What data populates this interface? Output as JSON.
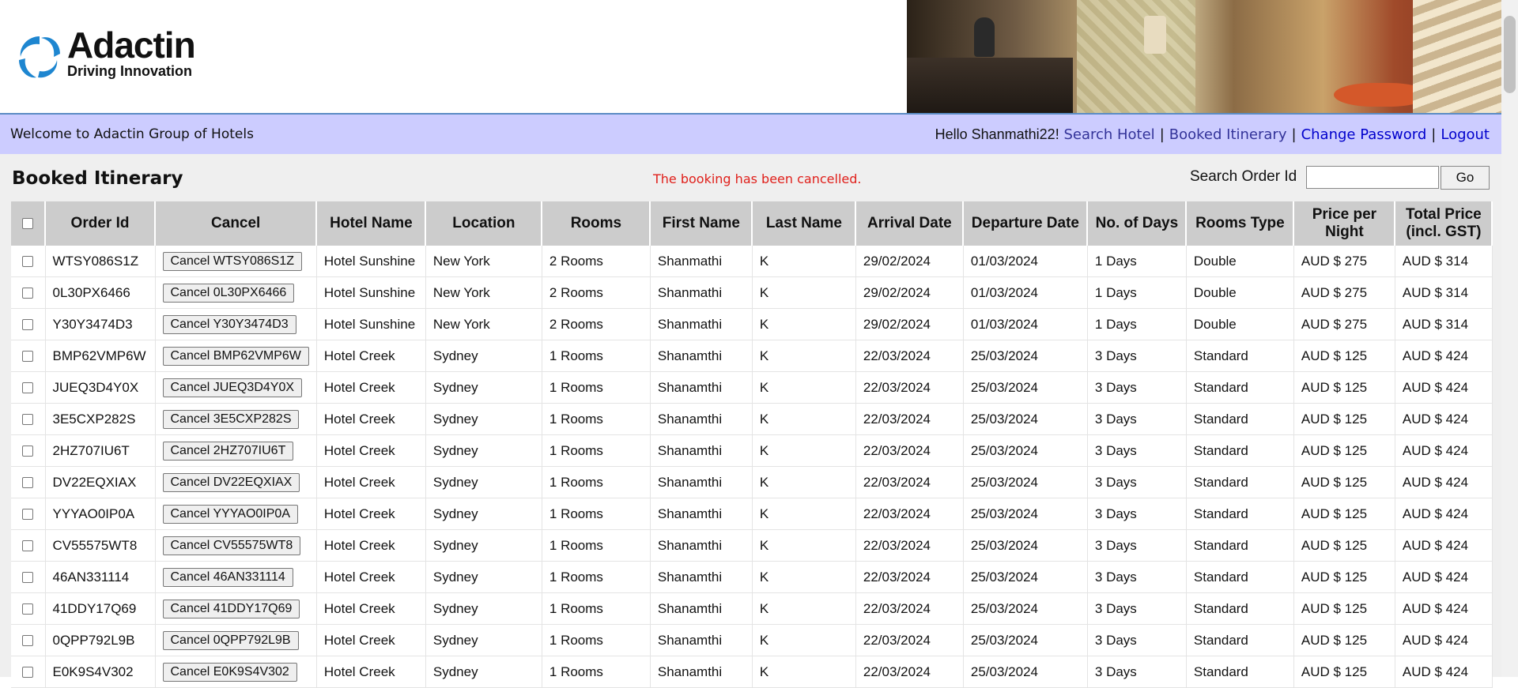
{
  "header": {
    "logo_name": "Adactin",
    "logo_tagline": "Driving Innovation",
    "colors": {
      "logo_blue": "#1e86d0",
      "header_line": "#5b8cc4"
    }
  },
  "welcome_bar": {
    "welcome_text": "Welcome to Adactin Group of Hotels",
    "hello": "Hello Shanmathi22!",
    "links": [
      "Search Hotel",
      "Booked Itinerary",
      "Change Password",
      "Logout"
    ],
    "separator": "|",
    "colors": {
      "bar_bg": "#ccccff",
      "link": "#333399"
    }
  },
  "page": {
    "title": "Booked Itinerary",
    "status_message": "The booking has been cancelled.",
    "status_color": "#e0201b",
    "search_label": "Search Order Id",
    "search_value": "",
    "go_label": "Go"
  },
  "table": {
    "headers": [
      "",
      "Order Id",
      "Cancel",
      "Hotel Name",
      "Location",
      "Rooms",
      "First Name",
      "Last Name",
      "Arrival Date",
      "Departure Date",
      "No. of Days",
      "Rooms Type",
      "Price per Night",
      "Total Price (incl. GST)"
    ],
    "rows": [
      {
        "order_id": "WTSY086S1Z",
        "cancel": "Cancel WTSY086S1Z",
        "hotel": "Hotel Sunshine",
        "location": "New York",
        "rooms": "2 Rooms",
        "first": "Shanmathi",
        "last": "K",
        "arrival": "29/02/2024",
        "departure": "01/03/2024",
        "days": "1 Days",
        "type": "Double",
        "price": "AUD $ 275",
        "total": "AUD $ 314"
      },
      {
        "order_id": "0L30PX6466",
        "cancel": "Cancel 0L30PX6466",
        "hotel": "Hotel Sunshine",
        "location": "New York",
        "rooms": "2 Rooms",
        "first": "Shanmathi",
        "last": "K",
        "arrival": "29/02/2024",
        "departure": "01/03/2024",
        "days": "1 Days",
        "type": "Double",
        "price": "AUD $ 275",
        "total": "AUD $ 314"
      },
      {
        "order_id": "Y30Y3474D3",
        "cancel": "Cancel Y30Y3474D3",
        "hotel": "Hotel Sunshine",
        "location": "New York",
        "rooms": "2 Rooms",
        "first": "Shanmathi",
        "last": "K",
        "arrival": "29/02/2024",
        "departure": "01/03/2024",
        "days": "1 Days",
        "type": "Double",
        "price": "AUD $ 275",
        "total": "AUD $ 314"
      },
      {
        "order_id": "BMP62VMP6W",
        "cancel": "Cancel BMP62VMP6W",
        "hotel": "Hotel Creek",
        "location": "Sydney",
        "rooms": "1 Rooms",
        "first": "Shanamthi",
        "last": "K",
        "arrival": "22/03/2024",
        "departure": "25/03/2024",
        "days": "3 Days",
        "type": "Standard",
        "price": "AUD $ 125",
        "total": "AUD $ 424"
      },
      {
        "order_id": "JUEQ3D4Y0X",
        "cancel": "Cancel JUEQ3D4Y0X",
        "hotel": "Hotel Creek",
        "location": "Sydney",
        "rooms": "1 Rooms",
        "first": "Shanamthi",
        "last": "K",
        "arrival": "22/03/2024",
        "departure": "25/03/2024",
        "days": "3 Days",
        "type": "Standard",
        "price": "AUD $ 125",
        "total": "AUD $ 424"
      },
      {
        "order_id": "3E5CXP282S",
        "cancel": "Cancel 3E5CXP282S",
        "hotel": "Hotel Creek",
        "location": "Sydney",
        "rooms": "1 Rooms",
        "first": "Shanamthi",
        "last": "K",
        "arrival": "22/03/2024",
        "departure": "25/03/2024",
        "days": "3 Days",
        "type": "Standard",
        "price": "AUD $ 125",
        "total": "AUD $ 424"
      },
      {
        "order_id": "2HZ707IU6T",
        "cancel": "Cancel 2HZ707IU6T",
        "hotel": "Hotel Creek",
        "location": "Sydney",
        "rooms": "1 Rooms",
        "first": "Shanamthi",
        "last": "K",
        "arrival": "22/03/2024",
        "departure": "25/03/2024",
        "days": "3 Days",
        "type": "Standard",
        "price": "AUD $ 125",
        "total": "AUD $ 424"
      },
      {
        "order_id": "DV22EQXIAX",
        "cancel": "Cancel DV22EQXIAX",
        "hotel": "Hotel Creek",
        "location": "Sydney",
        "rooms": "1 Rooms",
        "first": "Shanamthi",
        "last": "K",
        "arrival": "22/03/2024",
        "departure": "25/03/2024",
        "days": "3 Days",
        "type": "Standard",
        "price": "AUD $ 125",
        "total": "AUD $ 424"
      },
      {
        "order_id": "YYYAO0IP0A",
        "cancel": "Cancel YYYAO0IP0A",
        "hotel": "Hotel Creek",
        "location": "Sydney",
        "rooms": "1 Rooms",
        "first": "Shanamthi",
        "last": "K",
        "arrival": "22/03/2024",
        "departure": "25/03/2024",
        "days": "3 Days",
        "type": "Standard",
        "price": "AUD $ 125",
        "total": "AUD $ 424"
      },
      {
        "order_id": "CV55575WT8",
        "cancel": "Cancel CV55575WT8",
        "hotel": "Hotel Creek",
        "location": "Sydney",
        "rooms": "1 Rooms",
        "first": "Shanamthi",
        "last": "K",
        "arrival": "22/03/2024",
        "departure": "25/03/2024",
        "days": "3 Days",
        "type": "Standard",
        "price": "AUD $ 125",
        "total": "AUD $ 424"
      },
      {
        "order_id": "46AN331114",
        "cancel": "Cancel 46AN331114",
        "hotel": "Hotel Creek",
        "location": "Sydney",
        "rooms": "1 Rooms",
        "first": "Shanamthi",
        "last": "K",
        "arrival": "22/03/2024",
        "departure": "25/03/2024",
        "days": "3 Days",
        "type": "Standard",
        "price": "AUD $ 125",
        "total": "AUD $ 424"
      },
      {
        "order_id": "41DDY17Q69",
        "cancel": "Cancel 41DDY17Q69",
        "hotel": "Hotel Creek",
        "location": "Sydney",
        "rooms": "1 Rooms",
        "first": "Shanamthi",
        "last": "K",
        "arrival": "22/03/2024",
        "departure": "25/03/2024",
        "days": "3 Days",
        "type": "Standard",
        "price": "AUD $ 125",
        "total": "AUD $ 424"
      },
      {
        "order_id": "0QPP792L9B",
        "cancel": "Cancel 0QPP792L9B",
        "hotel": "Hotel Creek",
        "location": "Sydney",
        "rooms": "1 Rooms",
        "first": "Shanamthi",
        "last": "K",
        "arrival": "22/03/2024",
        "departure": "25/03/2024",
        "days": "3 Days",
        "type": "Standard",
        "price": "AUD $ 125",
        "total": "AUD $ 424"
      },
      {
        "order_id": "E0K9S4V302",
        "cancel": "Cancel E0K9S4V302",
        "hotel": "Hotel Creek",
        "location": "Sydney",
        "rooms": "1 Rooms",
        "first": "Shanamthi",
        "last": "K",
        "arrival": "22/03/2024",
        "departure": "25/03/2024",
        "days": "3 Days",
        "type": "Standard",
        "price": "AUD $ 125",
        "total": "AUD $ 424"
      }
    ]
  }
}
